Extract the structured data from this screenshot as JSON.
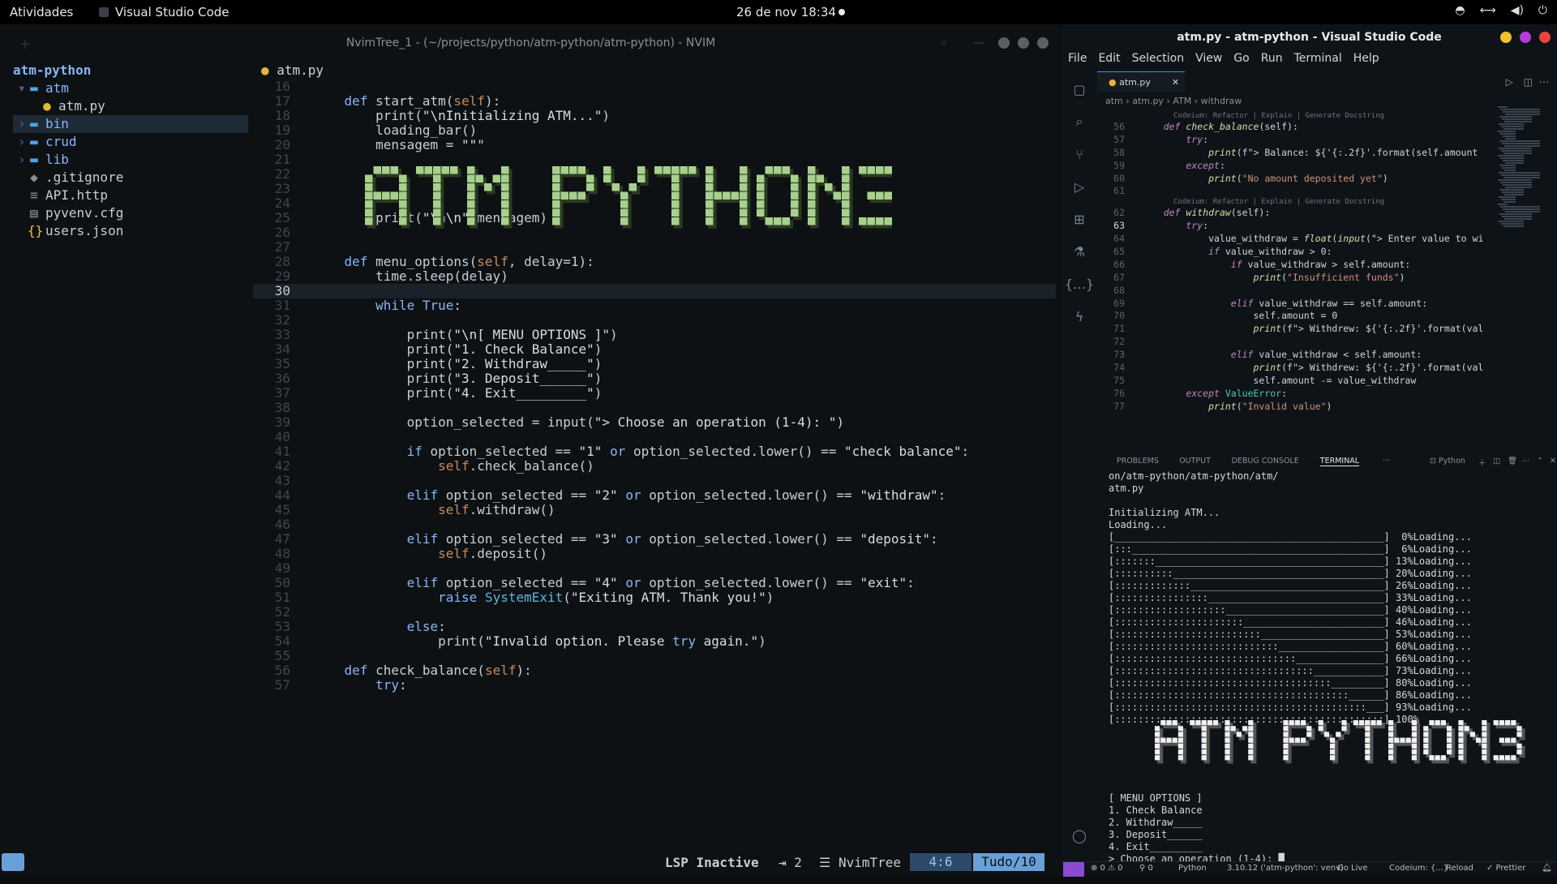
{
  "topbar": {
    "activities": "Atividades",
    "app_name": "Visual Studio Code",
    "clock": "26 de nov  18:34"
  },
  "nvim": {
    "window_title": "NvimTree_1 - (~/projects/python/atm-python/atm-python) - NVIM",
    "tree": {
      "root": "atm-python",
      "items": [
        {
          "label": "atm",
          "icon": "folder-open-icon",
          "indent": 1,
          "arrow": "▾"
        },
        {
          "label": "atm.py",
          "icon": "python-file-icon",
          "indent": 2,
          "arrow": ""
        },
        {
          "label": "bin",
          "icon": "folder-icon",
          "indent": 1,
          "arrow": "›"
        },
        {
          "label": "crud",
          "icon": "folder-icon",
          "indent": 1,
          "arrow": "›"
        },
        {
          "label": "lib",
          "icon": "folder-icon",
          "indent": 1,
          "arrow": "›"
        },
        {
          "label": ".gitignore",
          "icon": "git-file-icon",
          "indent": 1,
          "arrow": ""
        },
        {
          "label": "API.http",
          "icon": "text-file-icon",
          "indent": 1,
          "arrow": ""
        },
        {
          "label": "pyvenv.cfg",
          "icon": "config-file-icon",
          "indent": 1,
          "arrow": ""
        },
        {
          "label": "users.json",
          "icon": "json-file-icon",
          "indent": 1,
          "arrow": ""
        }
      ]
    },
    "buffer_tab": "atm.py",
    "banner": "ATM PYTHON3",
    "code": [
      {
        "n": "16",
        "t": ""
      },
      {
        "n": "17",
        "t": "    def start_atm(self):"
      },
      {
        "n": "18",
        "t": "        print(\"\\nInitializing ATM...\")"
      },
      {
        "n": "19",
        "t": "        loading_bar()"
      },
      {
        "n": "20",
        "t": "        mensagem = \"\"\""
      },
      {
        "n": "21",
        "t": ""
      },
      {
        "n": "22",
        "t": ""
      },
      {
        "n": "23",
        "t": ""
      },
      {
        "n": "24",
        "t": "        \"\"\""
      },
      {
        "n": "25",
        "t": "        print(\"\\n\\n\"+mensagem)"
      },
      {
        "n": "26",
        "t": ""
      },
      {
        "n": "27",
        "t": ""
      },
      {
        "n": "28",
        "t": "    def menu_options(self, delay=1):"
      },
      {
        "n": "29",
        "t": "        time.sleep(delay)"
      },
      {
        "n": "30",
        "t": ""
      },
      {
        "n": "31",
        "t": "        while True:"
      },
      {
        "n": "32",
        "t": ""
      },
      {
        "n": "33",
        "t": "            print(\"\\n[ MENU OPTIONS ]\")"
      },
      {
        "n": "34",
        "t": "            print(\"1. Check Balance\")"
      },
      {
        "n": "35",
        "t": "            print(\"2. Withdraw_____\")"
      },
      {
        "n": "36",
        "t": "            print(\"3. Deposit______\")"
      },
      {
        "n": "37",
        "t": "            print(\"4. Exit_________\")"
      },
      {
        "n": "38",
        "t": ""
      },
      {
        "n": "39",
        "t": "            option_selected = input(\"> Choose an operation (1-4): \")"
      },
      {
        "n": "40",
        "t": ""
      },
      {
        "n": "41",
        "t": "            if option_selected == \"1\" or option_selected.lower() == \"check balance\":"
      },
      {
        "n": "42",
        "t": "                self.check_balance()"
      },
      {
        "n": "43",
        "t": ""
      },
      {
        "n": "44",
        "t": "            elif option_selected == \"2\" or option_selected.lower() == \"withdraw\":"
      },
      {
        "n": "45",
        "t": "                self.withdraw()"
      },
      {
        "n": "46",
        "t": ""
      },
      {
        "n": "47",
        "t": "            elif option_selected == \"3\" or option_selected.lower() == \"deposit\":"
      },
      {
        "n": "48",
        "t": "                self.deposit()"
      },
      {
        "n": "49",
        "t": ""
      },
      {
        "n": "50",
        "t": "            elif option_selected == \"4\" or option_selected.lower() == \"exit\":"
      },
      {
        "n": "51",
        "t": "                raise SystemExit(\"Exiting ATM. Thank you!\")"
      },
      {
        "n": "52",
        "t": ""
      },
      {
        "n": "53",
        "t": "            else:"
      },
      {
        "n": "54",
        "t": "                print(\"Invalid option. Please try again.\")"
      },
      {
        "n": "55",
        "t": ""
      },
      {
        "n": "56",
        "t": "    def check_balance(self):"
      },
      {
        "n": "57",
        "t": "        try:"
      }
    ],
    "current_line": "30",
    "status": {
      "lsp": "LSP Inactive",
      "indent": "⇥ 2",
      "filetype": "NvimTree",
      "position": "4:6",
      "percent": "Tudo/10"
    }
  },
  "vscode": {
    "window_title": "atm.py - atm-python - Visual Studio Code",
    "menu": [
      "File",
      "Edit",
      "Selection",
      "View",
      "Go",
      "Run",
      "Terminal",
      "Help"
    ],
    "tab": "atm.py",
    "breadcrumb": [
      "atm",
      "atm.py",
      "ATM",
      "withdraw"
    ],
    "codelens": "Codeium: Refactor | Explain | Generate Docstring",
    "code": [
      {
        "n": "56",
        "t": "    def check_balance(self):",
        "lens": true
      },
      {
        "n": "57",
        "t": "        try:"
      },
      {
        "n": "58",
        "t": "            print(f\"> Balance: ${'{:.2f}'.format(self.amount"
      },
      {
        "n": "59",
        "t": "        except:"
      },
      {
        "n": "60",
        "t": "            print(\"No amount deposited yet\")"
      },
      {
        "n": "61",
        "t": ""
      },
      {
        "n": "62",
        "t": "    def withdraw(self):",
        "lens": true
      },
      {
        "n": "63",
        "t": "        try:"
      },
      {
        "n": "64",
        "t": "            value_withdraw = float(input(\"> Enter value to wi"
      },
      {
        "n": "65",
        "t": "            if value_withdraw > 0:"
      },
      {
        "n": "66",
        "t": "                if value_withdraw > self.amount:"
      },
      {
        "n": "67",
        "t": "                    print(\"Insufficient funds\")"
      },
      {
        "n": "68",
        "t": ""
      },
      {
        "n": "69",
        "t": "                elif value_withdraw == self.amount:"
      },
      {
        "n": "70",
        "t": "                    self.amount = 0"
      },
      {
        "n": "71",
        "t": "                    print(f\"> Withdrew: ${'{:.2f}'.format(val"
      },
      {
        "n": "72",
        "t": ""
      },
      {
        "n": "73",
        "t": "                elif value_withdraw < self.amount:"
      },
      {
        "n": "74",
        "t": "                    print(f\"> Withdrew: ${'{:.2f}'.format(val"
      },
      {
        "n": "75",
        "t": "                    self.amount -= value_withdraw"
      },
      {
        "n": "76",
        "t": "        except ValueError:"
      },
      {
        "n": "77",
        "t": "            print(\"Invalid value\")"
      }
    ],
    "current_line": "63",
    "panel_tabs": [
      "PROBLEMS",
      "OUTPUT",
      "DEBUG CONSOLE",
      "TERMINAL",
      "···"
    ],
    "terminal_profile": "Python",
    "terminal": [
      "on/atm-python/atm-python/atm/",
      "atm.py",
      "",
      "Initializing ATM...",
      "Loading...",
      "[______________________________________________]  0%Loading...",
      "[:::___________________________________________]  6%Loading...",
      "[:::::::_______________________________________] 13%Loading...",
      "[::::::::::____________________________________] 20%Loading...",
      "[:::::::::::::_________________________________] 26%Loading...",
      "[::::::::::::::::______________________________] 33%Loading...",
      "[:::::::::::::::::::___________________________] 40%Loading...",
      "[::::::::::::::::::::::________________________] 46%Loading...",
      "[:::::::::::::::::::::::::_____________________] 53%Loading...",
      "[::::::::::::::::::::::::::::__________________] 60%Loading...",
      "[:::::::::::::::::::::::::::::::_______________] 66%Loading...",
      "[::::::::::::::::::::::::::::::::::____________] 73%Loading...",
      "[:::::::::::::::::::::::::::::::::::::_________] 80%Loading...",
      "[::::::::::::::::::::::::::::::::::::::::______] 86%Loading...",
      "[:::::::::::::::::::::::::::::::::::::::::::___] 93%Loading...",
      "[::::::::::::::::::::::::::::::::::::::::::::::] 100%"
    ],
    "terminal_menu": [
      "[ MENU OPTIONS ]",
      "1. Check Balance",
      "2. Withdraw_____",
      "3. Deposit______",
      "4. Exit_________",
      "> Choose an operation (1-4): "
    ],
    "status": {
      "problems": "⊗ 0 ⚠ 0",
      "ports": "⚲ 0",
      "language": "Python",
      "interpreter": "3.10.12 ('atm-python': venv)",
      "golive": "Go Live",
      "codeium": "Codeium: {...}",
      "reload": "Reload",
      "prettier": "✓ Prettier"
    }
  },
  "colors": {
    "banner_green": "#a8d08d",
    "banner_dark": "#2a3a20",
    "terminal_banner": "#f0f0f0",
    "accent_blue": "#6aa0d8",
    "vscode_remote": "#8a4bd0"
  }
}
